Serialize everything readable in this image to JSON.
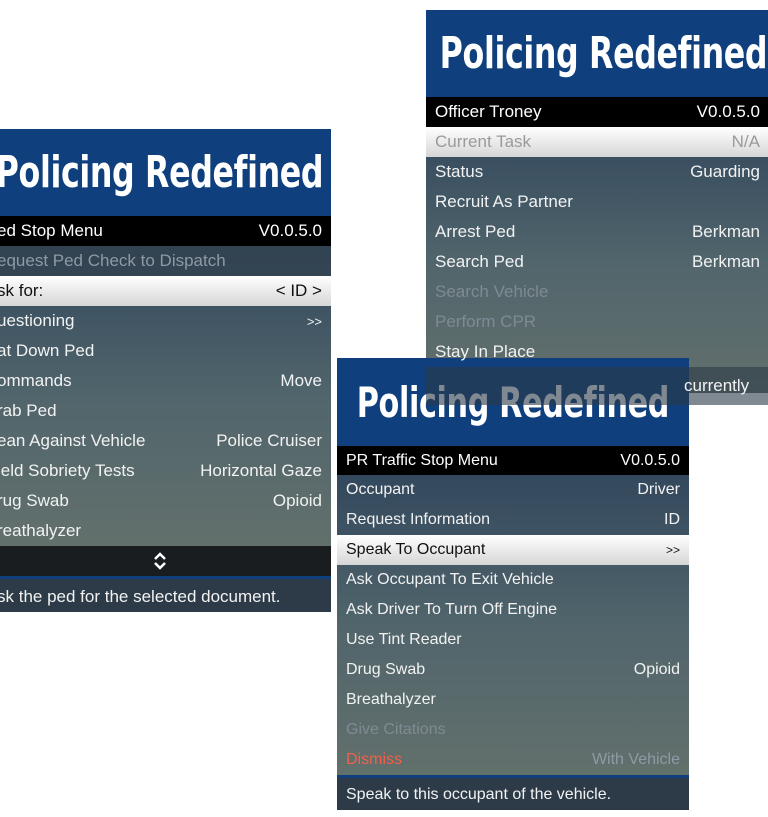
{
  "menu_left": {
    "title": "Policing Redefined",
    "header": {
      "label": "ed Stop Menu",
      "version": "V0.0.5.0"
    },
    "items": [
      {
        "label": "equest Ped Check to Dispatch",
        "value": ""
      },
      {
        "label": "sk for:",
        "value": "< ID >"
      },
      {
        "label": "uestioning",
        "value": ">>"
      },
      {
        "label": "at Down Ped",
        "value": ""
      },
      {
        "label": "ommands",
        "value": "Move"
      },
      {
        "label": "rab Ped",
        "value": ""
      },
      {
        "label": "ean Against Vehicle",
        "value": "Police Cruiser"
      },
      {
        "label": "ield Sobriety Tests",
        "value": "Horizontal Gaze"
      },
      {
        "label": "rug Swab",
        "value": "Opioid"
      },
      {
        "label": "reathalyzer",
        "value": ""
      }
    ],
    "scroll_icon": "up-down-chevron-icon",
    "description": "sk the ped for the selected document."
  },
  "menu_right": {
    "title": "Policing Redefined",
    "header": {
      "label": "Officer Troney",
      "version": "V0.0.5.0"
    },
    "items": [
      {
        "label": "Current Task",
        "value": "N/A"
      },
      {
        "label": "Status",
        "value": "Guarding"
      },
      {
        "label": "Recruit As Partner",
        "value": ""
      },
      {
        "label": "Arrest Ped",
        "value": "Berkman"
      },
      {
        "label": "Search Ped",
        "value": "Berkman"
      },
      {
        "label": "Search Vehicle",
        "value": ""
      },
      {
        "label": "Perform CPR",
        "value": ""
      },
      {
        "label": "Stay In Place",
        "value": ""
      }
    ],
    "description_fragment": "currently"
  },
  "menu_front": {
    "title": "Policing Redefined",
    "header": {
      "label": "PR Traffic Stop Menu",
      "version": "V0.0.5.0"
    },
    "items": [
      {
        "label": "Occupant",
        "value": "Driver"
      },
      {
        "label": "Request Information",
        "value": "ID"
      },
      {
        "label": "Speak To Occupant",
        "value": ">>"
      },
      {
        "label": "Ask Occupant To Exit Vehicle",
        "value": ""
      },
      {
        "label": "Ask Driver To Turn Off Engine",
        "value": ""
      },
      {
        "label": "Use Tint Reader",
        "value": ""
      },
      {
        "label": "Drug Swab",
        "value": "Opioid"
      },
      {
        "label": "Breathalyzer",
        "value": ""
      },
      {
        "label": "Give Citations",
        "value": ""
      },
      {
        "label": "Dismiss",
        "value": "With Vehicle"
      }
    ],
    "description": "Speak to this occupant of the vehicle."
  }
}
